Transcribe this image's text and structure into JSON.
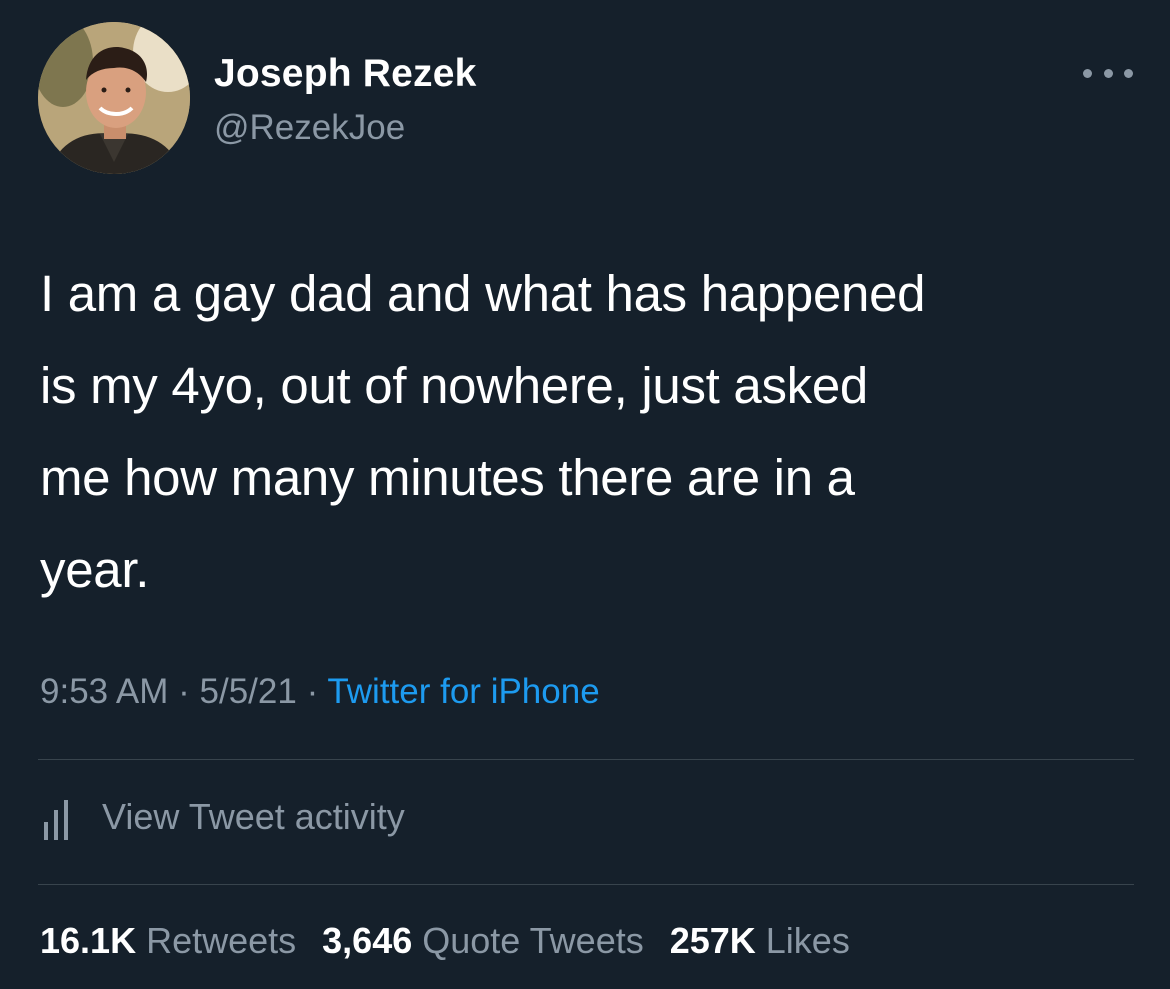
{
  "author": {
    "display_name": "Joseph Rezek",
    "handle": "@RezekJoe",
    "avatar_icon": "profile-photo"
  },
  "more_icon": "more-horizontal-icon",
  "tweet": {
    "lines": [
      "I am a gay dad and what has happened",
      "is my 4yo, out of nowhere, just asked",
      "me how many minutes there are in a",
      "year."
    ]
  },
  "meta": {
    "time": "9:53 AM",
    "sep1": " · ",
    "date": "5/5/21",
    "sep2": " · ",
    "source": "Twitter for iPhone"
  },
  "activity": {
    "icon": "bar-chart-icon",
    "label": "View Tweet activity"
  },
  "stats": {
    "retweets_count": "16.1K",
    "retweets_label": "Retweets",
    "quotes_count": "3,646",
    "quotes_label": "Quote Tweets",
    "likes_count": "257K",
    "likes_label": "Likes"
  },
  "colors": {
    "background": "#15202b",
    "primary_text": "#ffffff",
    "secondary_text": "#8b98a5",
    "accent": "#1d9bf0",
    "divider": "#38444d"
  }
}
